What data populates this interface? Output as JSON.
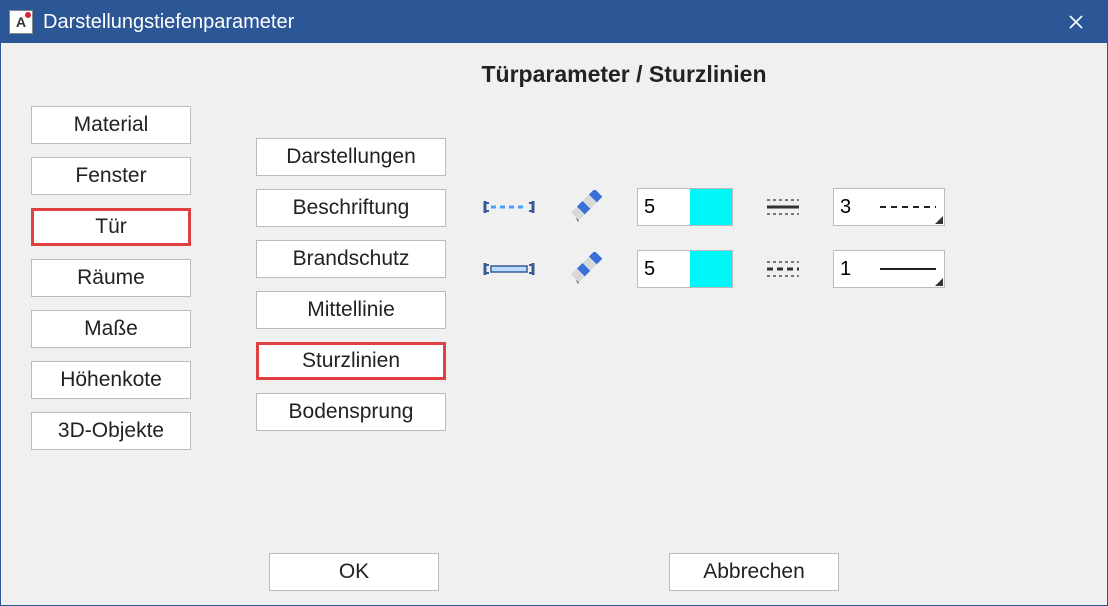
{
  "window": {
    "title": "Darstellungstiefenparameter",
    "app_icon_letter": "A"
  },
  "header": {
    "title": "Türparameter / Sturzlinien"
  },
  "left_tabs": [
    {
      "label": "Material",
      "highlighted": false
    },
    {
      "label": "Fenster",
      "highlighted": false
    },
    {
      "label": "Tür",
      "highlighted": true
    },
    {
      "label": "Räume",
      "highlighted": false
    },
    {
      "label": "Maße",
      "highlighted": false
    },
    {
      "label": "Höhenkote",
      "highlighted": false
    },
    {
      "label": "3D-Objekte",
      "highlighted": false
    }
  ],
  "sub_tabs": [
    {
      "label": "Darstellungen",
      "highlighted": false
    },
    {
      "label": "Beschriftung",
      "highlighted": false
    },
    {
      "label": "Brandschutz",
      "highlighted": false
    },
    {
      "label": "Mittellinie",
      "highlighted": false
    },
    {
      "label": "Sturzlinien",
      "highlighted": true
    },
    {
      "label": "Bodensprung",
      "highlighted": false
    }
  ],
  "rows": [
    {
      "num": "5",
      "swatch": "#00f7f7",
      "line_num": "3",
      "line_style": "dashed"
    },
    {
      "num": "5",
      "swatch": "#00f7f7",
      "line_num": "1",
      "line_style": "solid"
    }
  ],
  "footer": {
    "ok": "OK",
    "cancel": "Abbrechen"
  }
}
